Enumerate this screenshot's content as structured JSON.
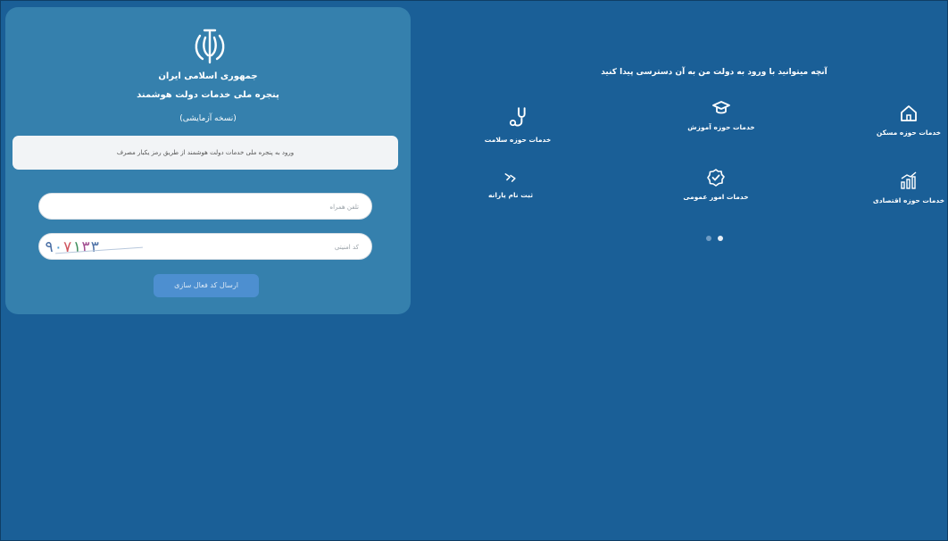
{
  "login": {
    "title_line1": "جمهوری اسلامی ایران",
    "title_line2": "پنجره ملی خدمات دولت هوشمند",
    "title_line3": "(نسخه آزمایشی)",
    "notice": "ورود به پنجره ملی خدمات دولت هوشمند از طریق رمز یکبار مصرف",
    "phone_placeholder": "تلفن همراه",
    "captcha_placeholder": "کد امنیتی",
    "captcha_text": [
      "۹",
      "۰",
      "۷",
      "۱",
      "۳",
      "۳"
    ],
    "submit_label": "ارسال کد فعال سازی"
  },
  "services": {
    "title": "آنچه میتوانید با ورود به دولت من به آن دسترسی پیدا کنید",
    "items": [
      {
        "label": "خدمات حوزه مسکن",
        "icon": "house-icon"
      },
      {
        "label": "خدمات حوزه آموزش",
        "icon": "graduation-cap-icon"
      },
      {
        "label": "خدمات حوزه سلامت",
        "icon": "stethoscope-icon"
      },
      {
        "label": "خدمات حوزه اقتصادی",
        "icon": "growth-chart-icon"
      },
      {
        "label": "خدمات امور عمومی",
        "icon": "badge-check-icon"
      },
      {
        "label": "ثبت نام یارانه",
        "icon": "subsidy-icon"
      }
    ],
    "carousel_active_index": 1
  },
  "colors": {
    "background": "#1a5f97",
    "panel": "#3580ad",
    "button": "#4d8fd0"
  }
}
